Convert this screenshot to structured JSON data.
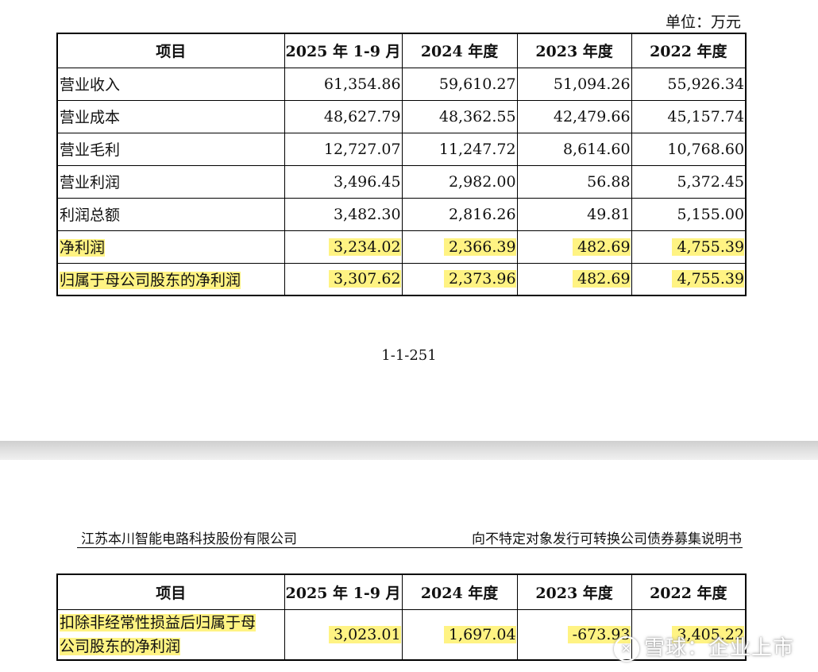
{
  "unit_label": "单位：万元",
  "columns": [
    "项目",
    "2025 年 1-9 月",
    "2024 年度",
    "2023 年度",
    "2022 年度"
  ],
  "table1_rows": [
    {
      "label": "营业收入",
      "values": [
        "61,354.86",
        "59,610.27",
        "51,094.26",
        "55,926.34"
      ]
    },
    {
      "label": "营业成本",
      "values": [
        "48,627.79",
        "48,362.55",
        "42,479.66",
        "45,157.74"
      ]
    },
    {
      "label": "营业毛利",
      "values": [
        "12,727.07",
        "11,247.72",
        "8,614.60",
        "10,768.60"
      ]
    },
    {
      "label": "营业利润",
      "values": [
        "3,496.45",
        "2,982.00",
        "56.88",
        "5,372.45"
      ]
    },
    {
      "label": "利润总额",
      "values": [
        "3,482.30",
        "2,816.26",
        "49.81",
        "5,155.00"
      ]
    },
    {
      "label": "净利润",
      "values": [
        "3,234.02",
        "2,366.39",
        "482.69",
        "4,755.39"
      ]
    },
    {
      "label": "归属于母公司股东的净利润",
      "values": [
        "3,307.62",
        "2,373.96",
        "482.69",
        "4,755.39"
      ]
    }
  ],
  "page_number": "1-1-251",
  "company_name": "江苏本川智能电路科技股份有限公司",
  "document_title": "向不特定对象发行可转换公司债券募集说明书",
  "table2_rows": [
    {
      "label_line1": "扣除非经常性损益后归属于母",
      "label_line2": "公司股东的净利润",
      "values": [
        "3,023.01",
        "1,697.04",
        "-673.93",
        "3,405.22"
      ]
    }
  ],
  "watermark": {
    "logo": "✕",
    "text": "雪球：企业上市"
  },
  "highlight_color": "#fff383"
}
